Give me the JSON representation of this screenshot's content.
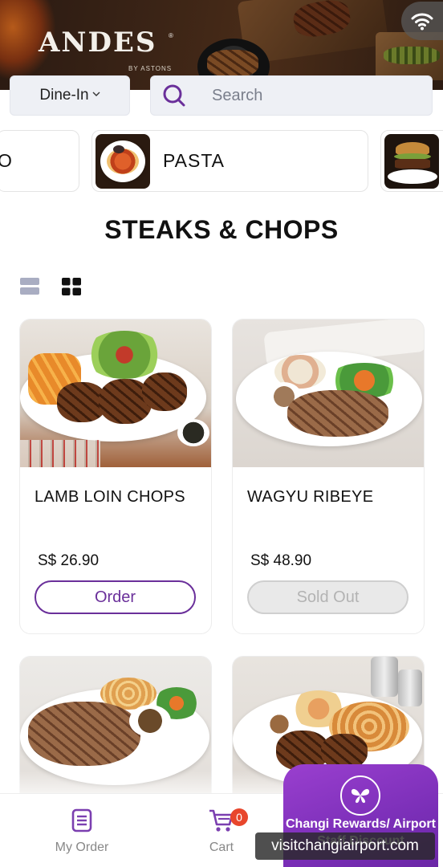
{
  "header": {
    "brand": "ANDES",
    "brand_sub": "BY ASTONS"
  },
  "controls": {
    "order_type": "Dine-In",
    "search_placeholder": "Search"
  },
  "categories": [
    {
      "label": "O"
    },
    {
      "label": "PASTA"
    },
    {
      "label": ""
    }
  ],
  "section": {
    "title": "STEAKS & CHOPS"
  },
  "products": [
    {
      "name": "LAMB LOIN CHOPS",
      "price": "S$ 26.90",
      "action": "Order"
    },
    {
      "name": "WAGYU RIBEYE",
      "price": "S$ 48.90",
      "action": "Sold Out"
    },
    {
      "name": "",
      "price": "",
      "action": ""
    },
    {
      "name": "",
      "price": "",
      "action": ""
    }
  ],
  "bottom_nav": {
    "my_order": "My Order",
    "cart": "Cart",
    "cart_count": "0",
    "rewards": "Changi Rewards/ Airport Staff Discount"
  },
  "watermark": "visitchangiairport.com",
  "colors": {
    "accent": "#6a2f9a",
    "badge": "#e8462c",
    "rewards_bg": "#7b2fb8"
  }
}
